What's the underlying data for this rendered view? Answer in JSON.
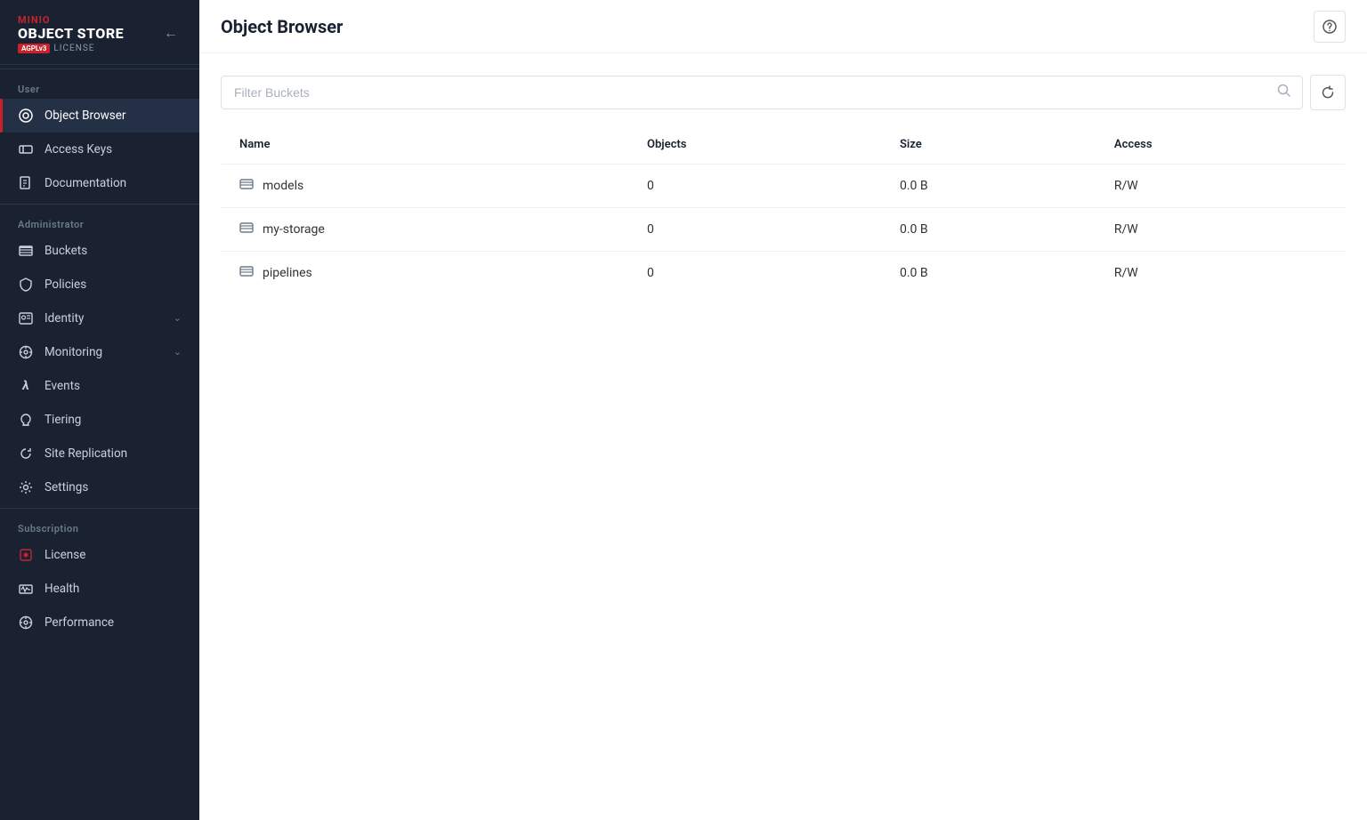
{
  "logo": {
    "brand": "MINIO",
    "product": "OBJECT STORE",
    "agpl_badge": "AGPLv3",
    "license": "LICENSE"
  },
  "page_title": "Object Browser",
  "filter": {
    "placeholder": "Filter Buckets"
  },
  "table": {
    "columns": [
      "Name",
      "Objects",
      "Size",
      "Access"
    ],
    "rows": [
      {
        "name": "models",
        "objects": "0",
        "size": "0.0 B",
        "access": "R/W"
      },
      {
        "name": "my-storage",
        "objects": "0",
        "size": "0.0 B",
        "access": "R/W"
      },
      {
        "name": "pipelines",
        "objects": "0",
        "size": "0.0 B",
        "access": "R/W"
      }
    ]
  },
  "sidebar": {
    "user_section": "User",
    "admin_section": "Administrator",
    "subscription_section": "Subscription",
    "items_user": [
      {
        "id": "object-browser",
        "label": "Object Browser",
        "icon": "⊙",
        "active": true
      },
      {
        "id": "access-keys",
        "label": "Access Keys",
        "icon": "🔑"
      },
      {
        "id": "documentation",
        "label": "Documentation",
        "icon": "📄"
      }
    ],
    "items_admin": [
      {
        "id": "buckets",
        "label": "Buckets",
        "icon": "≡"
      },
      {
        "id": "policies",
        "label": "Policies",
        "icon": "🔒"
      },
      {
        "id": "identity",
        "label": "Identity",
        "icon": "👤",
        "has_chevron": true
      },
      {
        "id": "monitoring",
        "label": "Monitoring",
        "icon": "🔍",
        "has_chevron": true
      },
      {
        "id": "events",
        "label": "Events",
        "icon": "λ"
      },
      {
        "id": "tiering",
        "label": "Tiering",
        "icon": "🎓"
      },
      {
        "id": "site-replication",
        "label": "Site Replication",
        "icon": "↻"
      },
      {
        "id": "settings",
        "label": "Settings",
        "icon": "⚙"
      }
    ],
    "items_subscription": [
      {
        "id": "license",
        "label": "License",
        "icon": "🔴"
      },
      {
        "id": "health",
        "label": "Health",
        "icon": "📊"
      },
      {
        "id": "performance",
        "label": "Performance",
        "icon": "⚙"
      }
    ]
  },
  "icons": {
    "collapse": "←",
    "help": "?",
    "search": "🔍",
    "refresh": "↻"
  }
}
